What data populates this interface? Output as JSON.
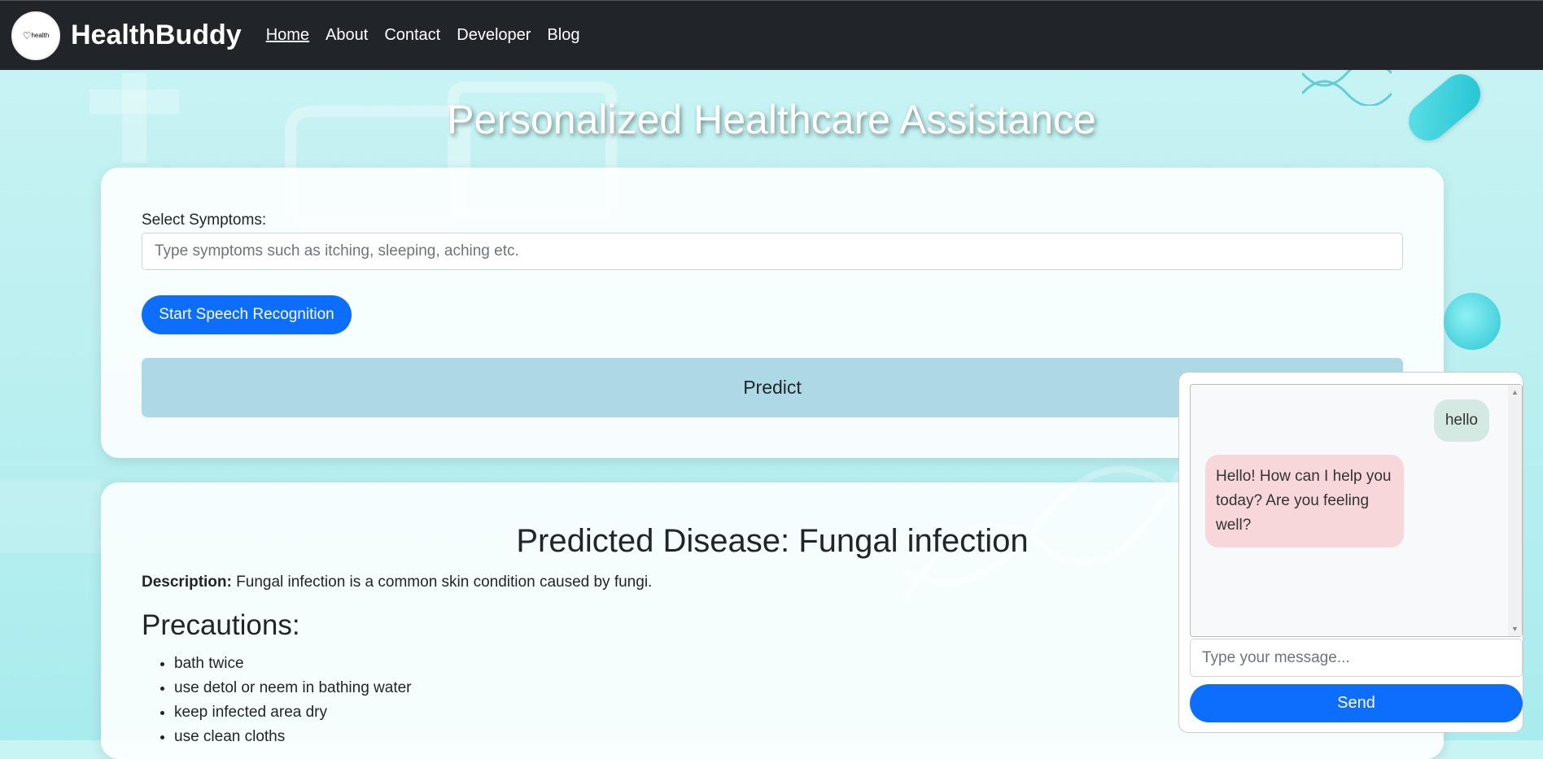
{
  "navbar": {
    "logo_text": "health",
    "brand": "HealthBuddy",
    "links": [
      "Home",
      "About",
      "Contact",
      "Developer",
      "Blog"
    ]
  },
  "hero": {
    "title": "Personalized Healthcare Assistance"
  },
  "form": {
    "label": "Select Symptoms:",
    "placeholder": "Type symptoms such as itching, sleeping, aching etc.",
    "value": "",
    "speech_button": "Start Speech Recognition",
    "predict_button": "Predict"
  },
  "result": {
    "title": "Predicted Disease: Fungal infection",
    "description_label": "Description:",
    "description": "Fungal infection is a common skin condition caused by fungi.",
    "precautions_title": "Precautions:",
    "precautions": [
      "bath twice",
      "use detol or neem in bathing water",
      "keep infected area dry",
      "use clean cloths"
    ]
  },
  "chat": {
    "messages": [
      {
        "sender": "user",
        "text": "hello"
      },
      {
        "sender": "bot",
        "text": "Hello! How can I help you today? Are you feeling well?"
      }
    ],
    "input_placeholder": "Type your message...",
    "send_button": "Send"
  },
  "colors": {
    "navbar": "#212529",
    "primary": "#0d6efd",
    "predict": "#add8e6",
    "user_bubble": "#d4e9e2",
    "bot_bubble": "#f8d7da"
  }
}
